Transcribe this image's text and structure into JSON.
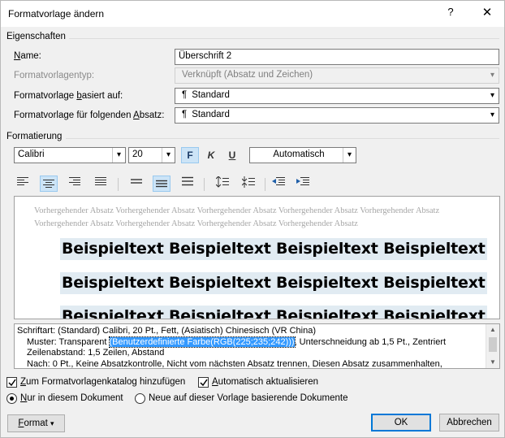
{
  "window": {
    "title": "Formatvorlage ändern",
    "help_glyph": "?",
    "close_glyph": "✕"
  },
  "properties": {
    "section_label": "Eigenschaften",
    "name_label_u": "N",
    "name_label_rest": "ame:",
    "name_value": "Überschrift 2",
    "type_label": "Formatvorlagentyp:",
    "type_value": "Verknüpft (Absatz und Zeichen)",
    "based_label_pre": "Formatvorlage ",
    "based_label_u": "b",
    "based_label_post": "asiert auf:",
    "based_value": "Standard",
    "next_label_pre": "Formatvorlage für folgenden ",
    "next_label_u": "A",
    "next_label_post": "bsatz:",
    "next_value": "Standard",
    "para_glyph": "¶"
  },
  "formatting": {
    "section_label": "Formatierung",
    "font_name": "Calibri",
    "font_size": "20",
    "bold_label": "F",
    "italic_label": "K",
    "underline_label": "U",
    "color_value": "Automatisch",
    "active_bg": "#cce4f7"
  },
  "preview": {
    "previous_paragraph": "Vorhergehender Absatz Vorhergehender Absatz Vorhergehender Absatz Vorhergehender Absatz Vorhergehender Absatz Vorhergehender Absatz Vorhergehender Absatz Vorhergehender Absatz Vorhergehender Absatz",
    "sample_lines": [
      "Beispieltext Beispieltext Beispieltext Beispieltext",
      "Beispieltext Beispieltext Beispieltext Beispieltext",
      "Beispieltext Beispieltext Beispieltext Beispieltext"
    ],
    "shading_color": "#e1ebf2"
  },
  "description": {
    "line1": "Schriftart: (Standard) Calibri, 20 Pt., Fett, (Asiatisch) Chinesisch (VR China)",
    "line2_pre": "Muster: Transparent ",
    "line2_highlight": "(Benutzerdefinierte Farbe(RGB(225;235;242)))",
    "line2_post": ", Unterschneidung ab 1,5 Pt., Zentriert",
    "line3": "Zeilenabstand:  1,5 Zeilen, Abstand",
    "line4": "Nach:  0 Pt., Keine Absatzkontrolle, Nicht vom nächsten Absatz trennen, Diesen Absatz zusammenhalten,"
  },
  "options": {
    "add_to_gallery_u": "Z",
    "add_to_gallery_rest": "um Formatvorlagenkatalog hinzufügen",
    "auto_update_u": "A",
    "auto_update_rest": "utomatisch aktualisieren",
    "only_doc_u": "N",
    "only_doc_rest": "ur in diesem Dokument",
    "new_docs": "Neue auf dieser Vorlage basierende Dokumente"
  },
  "buttons": {
    "format_u": "F",
    "format_rest": "ormat",
    "format_arrow": "▾",
    "ok": "OK",
    "cancel": "Abbrechen"
  }
}
